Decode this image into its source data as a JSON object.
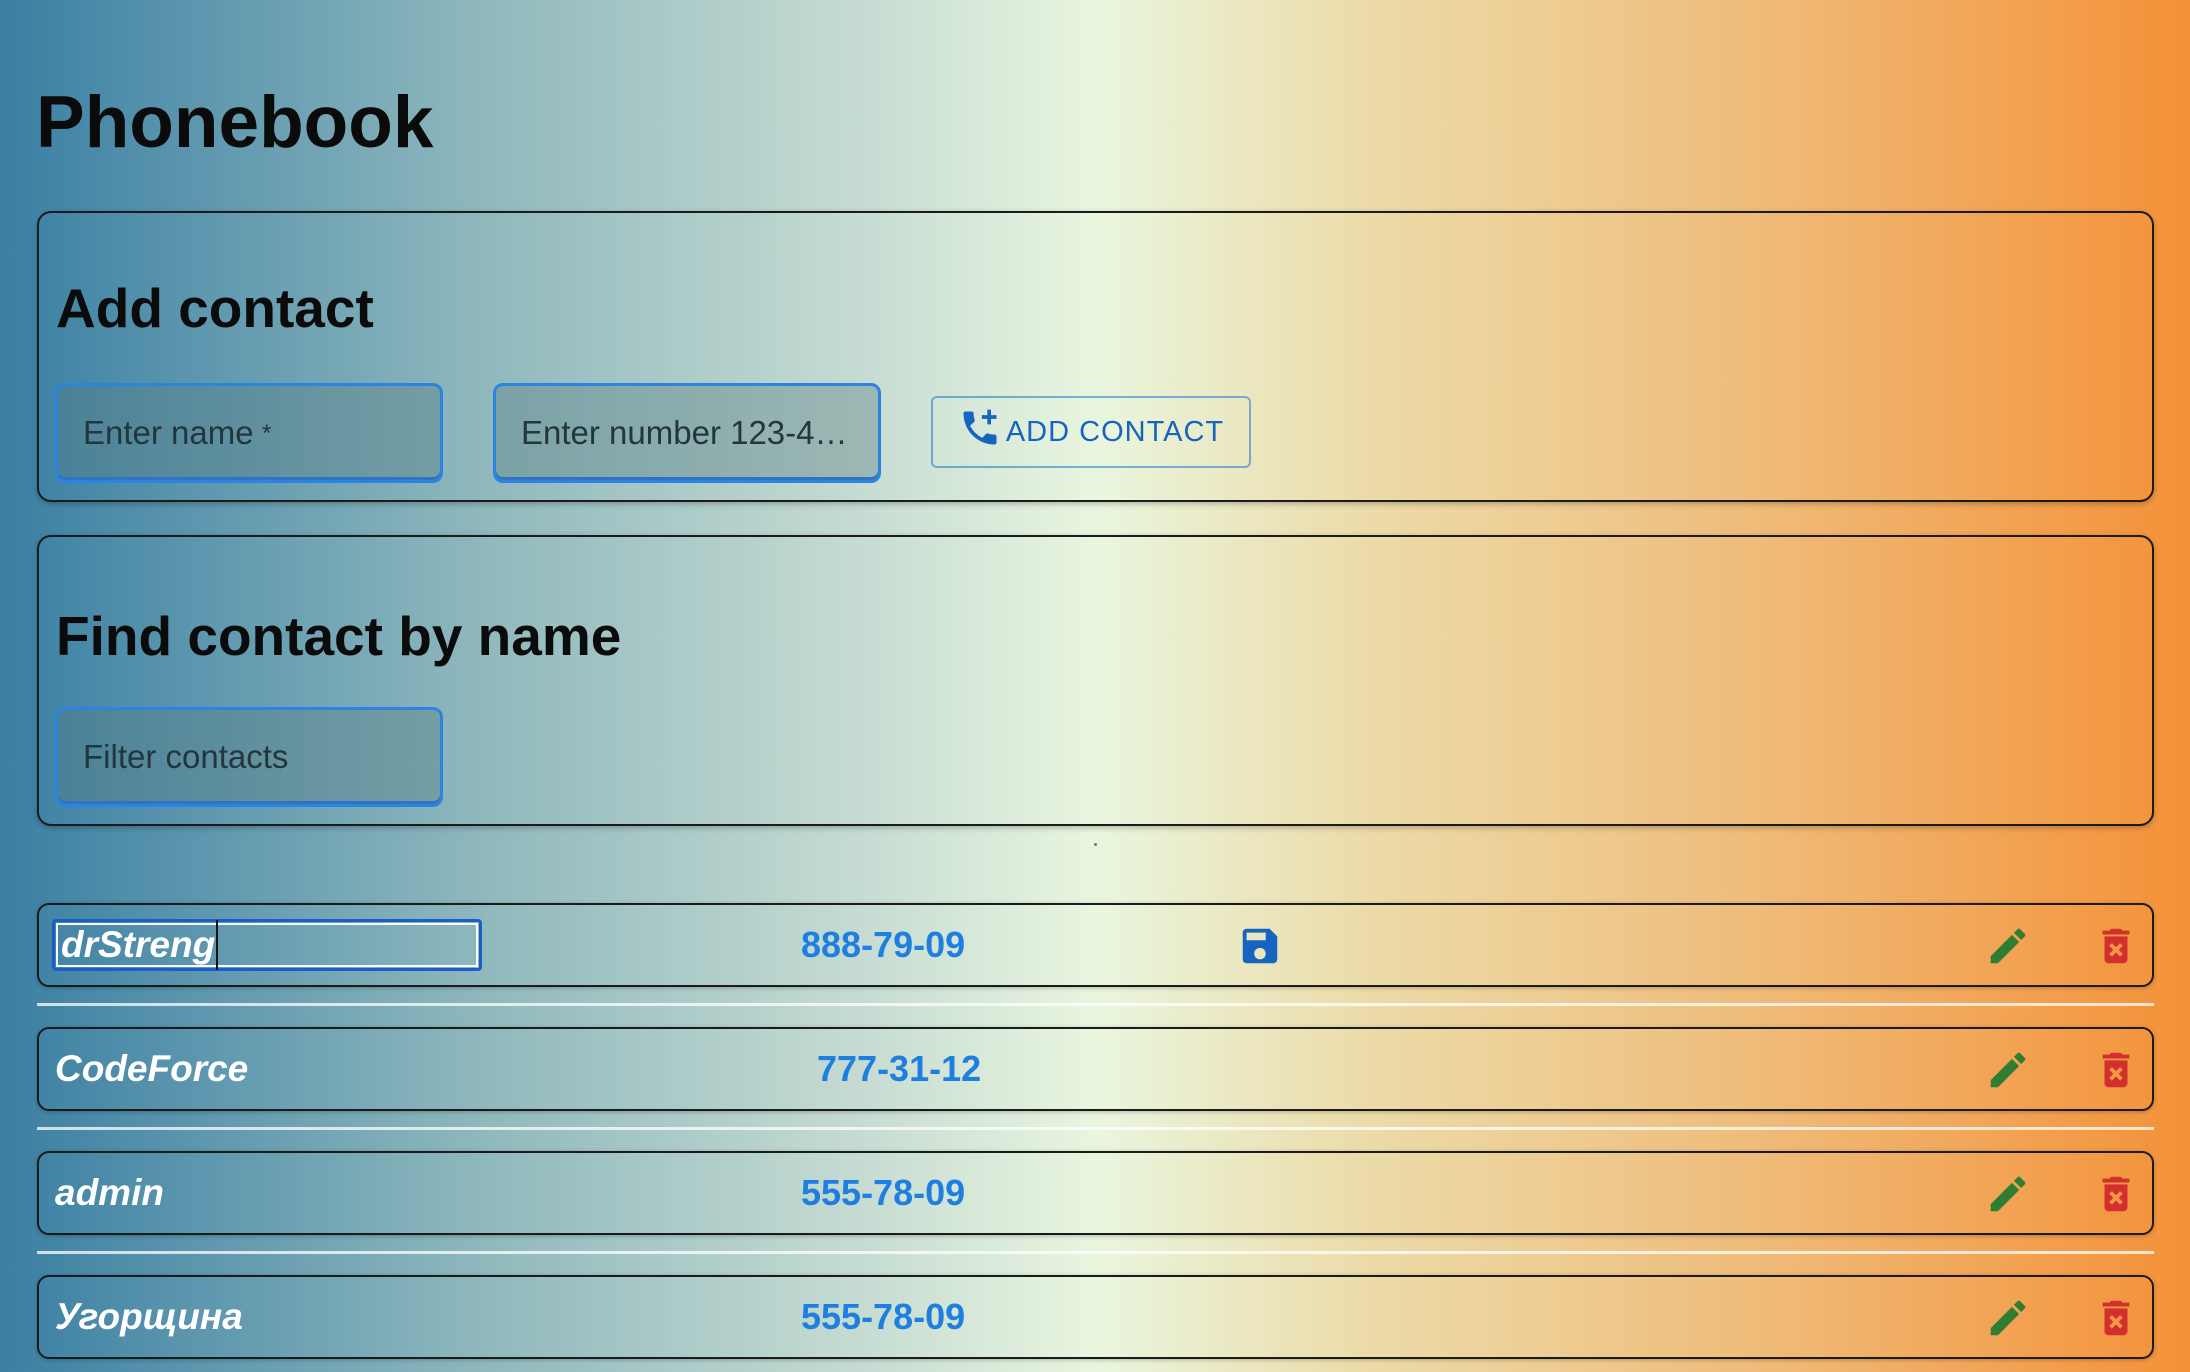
{
  "title": "Phonebook",
  "add_section": {
    "heading": "Add contact",
    "name_placeholder": "Enter name",
    "name_required_mark": "*",
    "number_placeholder": "Enter number 123-4…",
    "button_label": "ADD CONTACT",
    "button_icon": "add-call-icon"
  },
  "find_section": {
    "heading": "Find contact by name",
    "filter_placeholder": "Filter contacts"
  },
  "contacts": [
    {
      "name": "drStreng",
      "number": "888-79-09",
      "editing": true
    },
    {
      "name": "CodeForce",
      "number": "777-31-12",
      "editing": false
    },
    {
      "name": "admin",
      "number": "555-78-09",
      "editing": false
    },
    {
      "name": "Угорщина",
      "number": "555-78-09",
      "editing": false
    }
  ],
  "icons": {
    "save": "save-icon",
    "edit": "pencil-icon",
    "delete": "delete-icon"
  },
  "colors": {
    "accent": "#1f7fe0",
    "edit": "#2e7d32",
    "delete": "#d32f2f",
    "save": "#1565c0"
  }
}
